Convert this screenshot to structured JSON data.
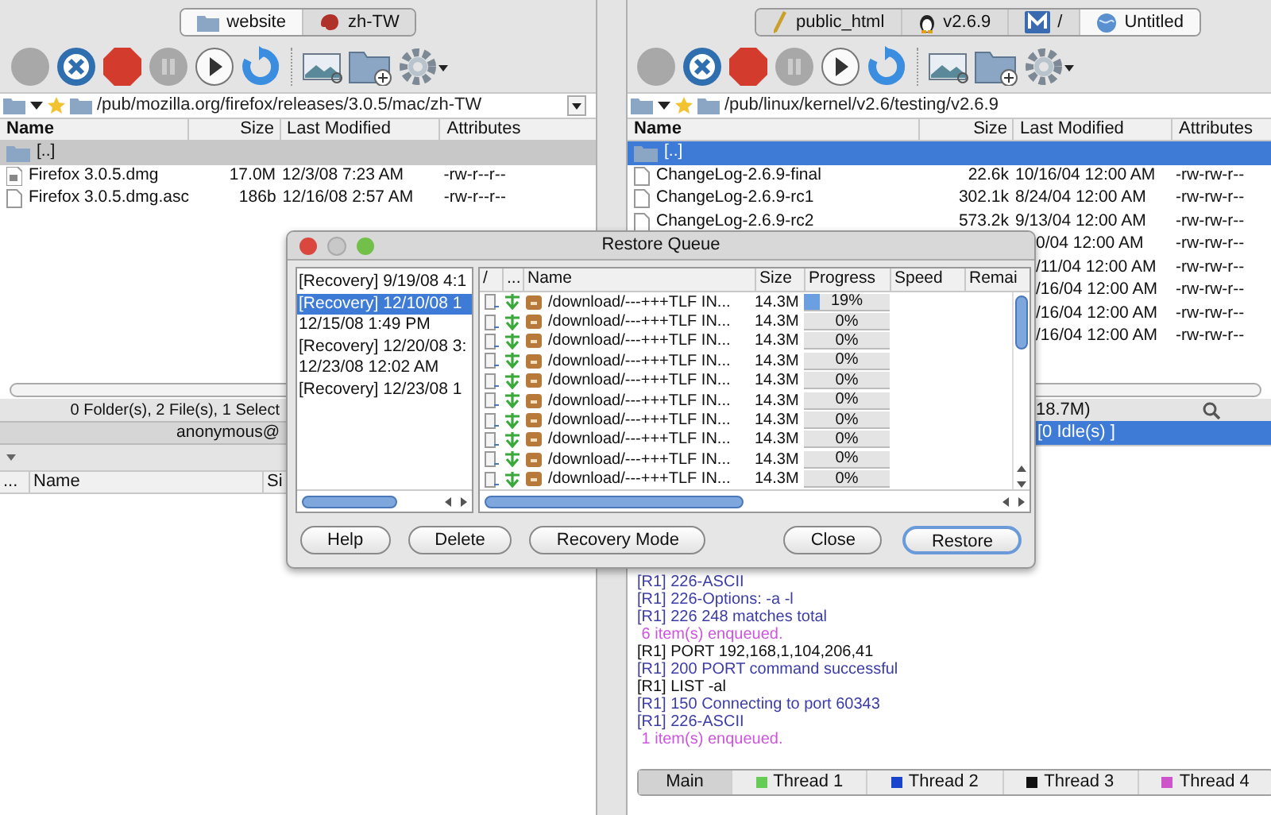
{
  "panes": [
    {
      "active": false,
      "tabs": [
        {
          "label": "website",
          "kind": "folder",
          "selected": true
        },
        {
          "label": "zh-TW",
          "kind": "critter",
          "selected": false
        }
      ],
      "toolbar": [
        {
          "kind": "connect",
          "disabled": true
        },
        {
          "kind": "disconnect",
          "disabled": false
        },
        {
          "kind": "stop",
          "disabled": false
        },
        {
          "kind": "pause",
          "disabled": true
        },
        {
          "kind": "play",
          "disabled": false
        },
        {
          "kind": "refresh",
          "disabled": false
        },
        {
          "kind": "preview",
          "disabled": false
        },
        {
          "kind": "newfolder",
          "disabled": false
        },
        {
          "kind": "settings",
          "disabled": false
        }
      ],
      "path": {
        "text": "/pub/mozilla.org/firefox/releases/3.0.5/mac/zh-TW",
        "dropdown": true
      },
      "columns": [
        "Name",
        "Size",
        "Last Modified",
        "Attributes"
      ],
      "files": [
        {
          "kind": "folder",
          "name": "[..]",
          "selected": true
        },
        {
          "kind": "disk",
          "name": "Firefox 3.0.5.dmg",
          "size": "17.0M",
          "modified": "12/3/08 7:23 AM",
          "attributes": "-rw-r--r--",
          "selected": false
        },
        {
          "kind": "document",
          "name": "Firefox 3.0.5.dmg.asc",
          "size": "186b",
          "modified": "12/16/08 2:57 AM",
          "attributes": "-rw-r--r--",
          "selected": false
        }
      ],
      "status": "0 Folder(s), 2 File(s), 1 Select",
      "connection": "anonymous@",
      "queue_columns": [
        "...",
        "Name",
        "Si"
      ]
    },
    {
      "active": true,
      "tabs": [
        {
          "label": "public_html",
          "kind": "pen",
          "selected": false
        },
        {
          "label": "v2.6.9",
          "kind": "penguin",
          "selected": false
        },
        {
          "label": "/",
          "kind": "app",
          "selected": false
        },
        {
          "label": "Untitled",
          "kind": "globe",
          "selected": true
        }
      ],
      "toolbar": [
        {
          "kind": "connect",
          "disabled": true
        },
        {
          "kind": "disconnect",
          "disabled": false
        },
        {
          "kind": "stop",
          "disabled": false
        },
        {
          "kind": "pause",
          "disabled": true
        },
        {
          "kind": "play",
          "disabled": false
        },
        {
          "kind": "refresh",
          "disabled": false
        },
        {
          "kind": "preview",
          "disabled": false
        },
        {
          "kind": "newfolder",
          "disabled": false
        },
        {
          "kind": "settings",
          "disabled": false
        }
      ],
      "path": {
        "text": "/pub/linux/kernel/v2.6/testing/v2.6.9"
      },
      "columns": [
        "Name",
        "Size",
        "Last Modified",
        "Attributes"
      ],
      "files": [
        {
          "kind": "folder",
          "name": "[..]",
          "selected": true
        },
        {
          "kind": "document",
          "name": "ChangeLog-2.6.9-final",
          "size": "22.6k",
          "modified": "10/16/04 12:00 AM",
          "attributes": "-rw-rw-r--",
          "selected": false
        },
        {
          "kind": "document",
          "name": "ChangeLog-2.6.9-rc1",
          "size": "302.1k",
          "modified": "8/24/04 12:00 AM",
          "attributes": "-rw-rw-r--",
          "selected": false
        },
        {
          "kind": "document",
          "name": "ChangeLog-2.6.9-rc2",
          "size": "573.2k",
          "modified": "9/13/04 12:00 AM",
          "attributes": "-rw-rw-r--",
          "selected": false
        },
        {
          "kind": "hidden",
          "modified": "0/04 12:00 AM",
          "attributes": "-rw-rw-r--",
          "selected": false
        },
        {
          "kind": "hidden",
          "modified": "/11/04 12:00 AM",
          "attributes": "-rw-rw-r--",
          "selected": false
        },
        {
          "kind": "hidden",
          "modified": "/16/04 12:00 AM",
          "attributes": "-rw-rw-r--",
          "selected": false
        },
        {
          "kind": "hidden",
          "modified": "/16/04 12:00 AM",
          "attributes": "-rw-rw-r--",
          "selected": false
        },
        {
          "kind": "hidden",
          "modified": "/16/04 12:00 AM",
          "attributes": "-rw-rw-r--",
          "selected": false
        }
      ],
      "status": "18.7M)",
      "connection": "[0 Idle(s) ]",
      "log": [
        {
          "text": "[R1] 226-ASCII",
          "color": "#3c3ca8"
        },
        {
          "text": "[R1] 226-Options: -a -l",
          "color": "#3c3ca8"
        },
        {
          "text": "[R1] 226 248 matches total",
          "color": "#3c3ca8"
        },
        {
          "text": " 6 item(s) enqueued.",
          "color": "#cc55dd"
        },
        {
          "text": "[R1] PORT 192,168,1,104,206,41",
          "color": "#111111"
        },
        {
          "text": "[R1] 200 PORT command successful",
          "color": "#3c3ca8"
        },
        {
          "text": "[R1] LIST -al",
          "color": "#111111"
        },
        {
          "text": "[R1] 150 Connecting to port 60343",
          "color": "#3c3ca8"
        },
        {
          "text": "[R1] 226-ASCII",
          "color": "#3c3ca8"
        },
        {
          "text": " 1 item(s) enqueued.",
          "color": "#cc55dd"
        }
      ],
      "threads": [
        {
          "label": "Main",
          "selected": true
        },
        {
          "label": "Thread 1",
          "color": "#66cc55",
          "selected": false
        },
        {
          "label": "Thread 2",
          "color": "#1a44cc",
          "selected": false
        },
        {
          "label": "Thread 3",
          "color": "#111111",
          "selected": false
        },
        {
          "label": "Thread 4",
          "color": "#cc55cc",
          "selected": false
        }
      ]
    }
  ],
  "dialog": {
    "title": "Restore Queue",
    "sessions": [
      {
        "label": "[Recovery] 9/19/08 4:1",
        "selected": false
      },
      {
        "label": "[Recovery] 12/10/08 1",
        "selected": true
      },
      {
        "label": "12/15/08 1:49 PM",
        "selected": false
      },
      {
        "label": "[Recovery] 12/20/08 3:",
        "selected": false
      },
      {
        "label": "12/23/08 12:02 AM",
        "selected": false
      },
      {
        "label": "[Recovery] 12/23/08 1",
        "selected": false
      }
    ],
    "columns": [
      "/",
      "...",
      "Name",
      "Size",
      "Progress",
      "Speed",
      "Remai"
    ],
    "rows": [
      {
        "name": "/download/---+++TLF IN...",
        "size": "14.3M",
        "progress": "19%",
        "level": 0.19
      },
      {
        "name": "/download/---+++TLF IN...",
        "size": "14.3M",
        "progress": "0%",
        "level": 0
      },
      {
        "name": "/download/---+++TLF IN...",
        "size": "14.3M",
        "progress": "0%",
        "level": 0
      },
      {
        "name": "/download/---+++TLF IN...",
        "size": "14.3M",
        "progress": "0%",
        "level": 0
      },
      {
        "name": "/download/---+++TLF IN...",
        "size": "14.3M",
        "progress": "0%",
        "level": 0
      },
      {
        "name": "/download/---+++TLF IN...",
        "size": "14.3M",
        "progress": "0%",
        "level": 0
      },
      {
        "name": "/download/---+++TLF IN...",
        "size": "14.3M",
        "progress": "0%",
        "level": 0
      },
      {
        "name": "/download/---+++TLF IN...",
        "size": "14.3M",
        "progress": "0%",
        "level": 0
      },
      {
        "name": "/download/---+++TLF IN...",
        "size": "14.3M",
        "progress": "0%",
        "level": 0
      },
      {
        "name": "/download/---+++TLF IN...",
        "size": "14.3M",
        "progress": "0%",
        "level": 0
      }
    ],
    "buttons_left": [
      {
        "label": "Help",
        "default": false
      },
      {
        "label": "Delete",
        "default": false
      },
      {
        "label": "Recovery Mode",
        "default": false
      }
    ],
    "buttons_right": [
      {
        "label": "Close",
        "default": false
      },
      {
        "label": "Restore",
        "default": true
      }
    ]
  }
}
